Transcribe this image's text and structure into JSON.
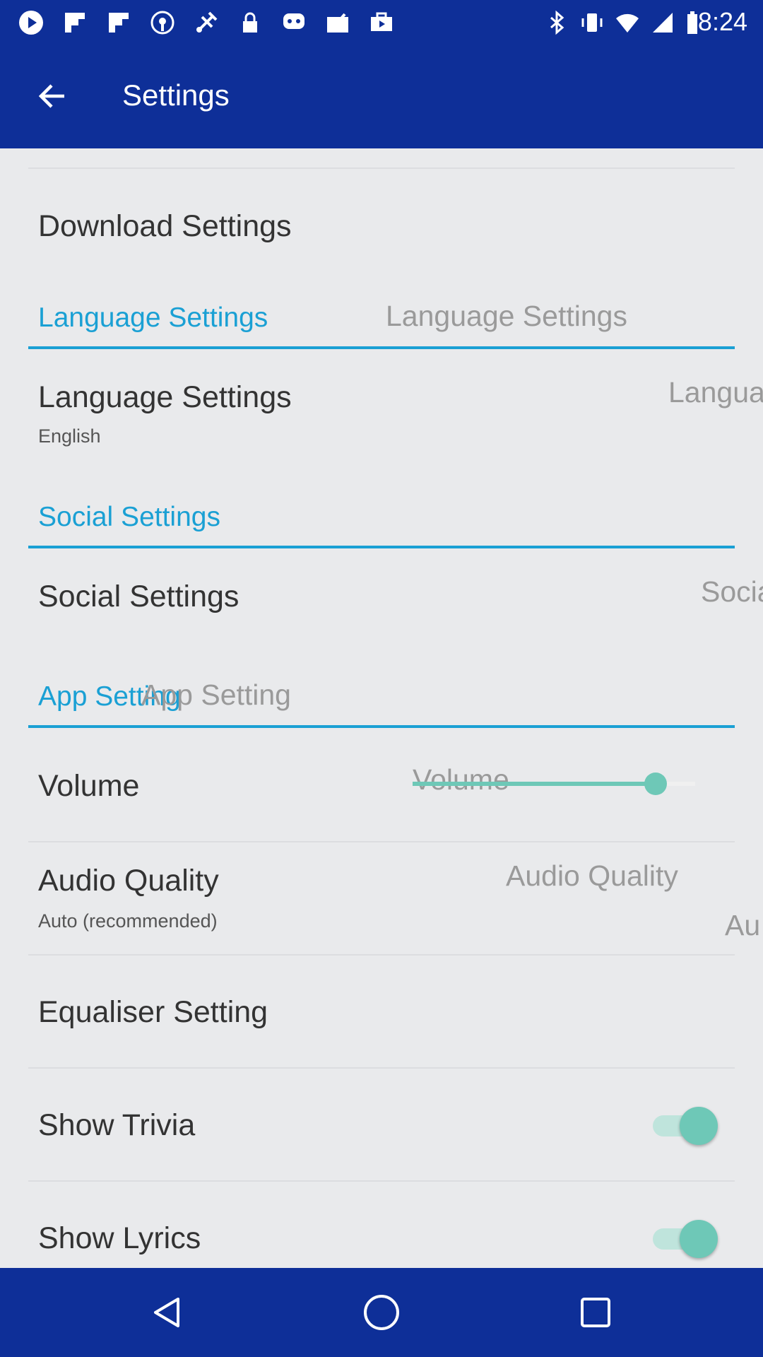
{
  "status_bar": {
    "time": "8:24",
    "icons": [
      "play-icon",
      "flipboard-icon",
      "flipboard-icon",
      "podcast-icon",
      "satellite-icon",
      "lock-icon",
      "chat-icon",
      "mail-check-icon",
      "briefcase-icon",
      "bluetooth-icon",
      "vibrate-icon",
      "wifi-icon",
      "signal-icon",
      "battery-icon"
    ]
  },
  "app_bar": {
    "title": "Settings",
    "back_icon": "arrow-left-icon"
  },
  "download": {
    "heading": "Download Settings"
  },
  "language_section": {
    "header": "Language Settings",
    "header_ghost": "Language Settings"
  },
  "language_item": {
    "title": "Language Settings",
    "value": "English",
    "ghost": "Langua"
  },
  "social_section": {
    "header": "Social Settings"
  },
  "social_item": {
    "title": "Social Settings",
    "ghost": "Socia"
  },
  "app_section": {
    "header": "App Setting",
    "header_ghost": "App Setting"
  },
  "volume": {
    "title": "Volume",
    "ghost": "Volume",
    "level": 0.86
  },
  "audio_quality": {
    "title": "Audio Quality",
    "value": "Auto (recommended)",
    "ghost": "Audio Quality",
    "ghost_value": "Au"
  },
  "equaliser": {
    "title": "Equaliser Setting"
  },
  "show_trivia": {
    "title": "Show Trivia",
    "enabled": true
  },
  "show_lyrics": {
    "title": "Show Lyrics",
    "enabled": true
  },
  "nav": {
    "icons": [
      "back-triangle-icon",
      "home-circle-icon",
      "recents-square-icon"
    ]
  },
  "colors": {
    "primary": "#0e2f98",
    "accent": "#1aa0d4",
    "teal": "#6ec8b7",
    "background": "#e9eaec"
  }
}
